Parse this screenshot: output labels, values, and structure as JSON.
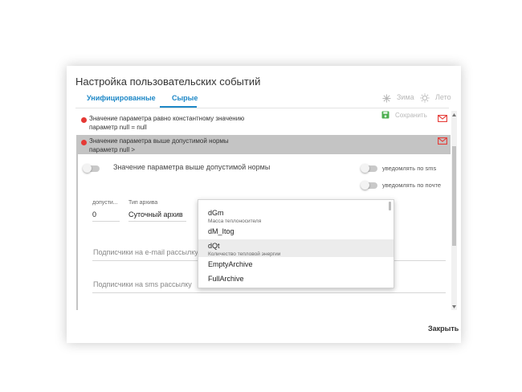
{
  "dialog": {
    "title": "Настройка пользовательских событий",
    "tabs": [
      {
        "label": "Унифицированные"
      },
      {
        "label": "Сырые"
      }
    ],
    "season": {
      "winter": "Зима",
      "summer": "Лето"
    },
    "save_label": "Сохранить",
    "close_label": "Закрыть"
  },
  "events": [
    {
      "line1": "Значение параметра равно константному значению",
      "line2": "параметр null = null"
    },
    {
      "line1": "Значение параметра выше допустимой нормы",
      "line2": "параметр null >"
    }
  ],
  "detail": {
    "toggle_label": "Значение параметра выше допустимой нормы",
    "notify_sms": "уведомлять по sms",
    "notify_mail": "уведомлять по почте",
    "field1_label": "допусти...",
    "field1_value": "0",
    "field2_label": "Тип архива",
    "field2_value": "Суточный архив",
    "email_subscribers": "Подписчики на e-mail рассылку",
    "sms_subscribers": "Подписчики на sms рассылку"
  },
  "dropdown": {
    "options": [
      {
        "label": "dGm",
        "sub": "Масса теплоносителя"
      },
      {
        "label": "dM_Itog",
        "sub": ""
      },
      {
        "label": "dQt",
        "sub": "Количество тепловой энергии"
      },
      {
        "label": "EmptyArchive",
        "sub": ""
      },
      {
        "label": "FullArchive",
        "sub": ""
      }
    ],
    "highlighted_index": 2
  },
  "colors": {
    "accent": "#1e88c7",
    "alert": "#e53935",
    "save_icon": "#4caf50",
    "selected_row": "#c4c4c4"
  }
}
